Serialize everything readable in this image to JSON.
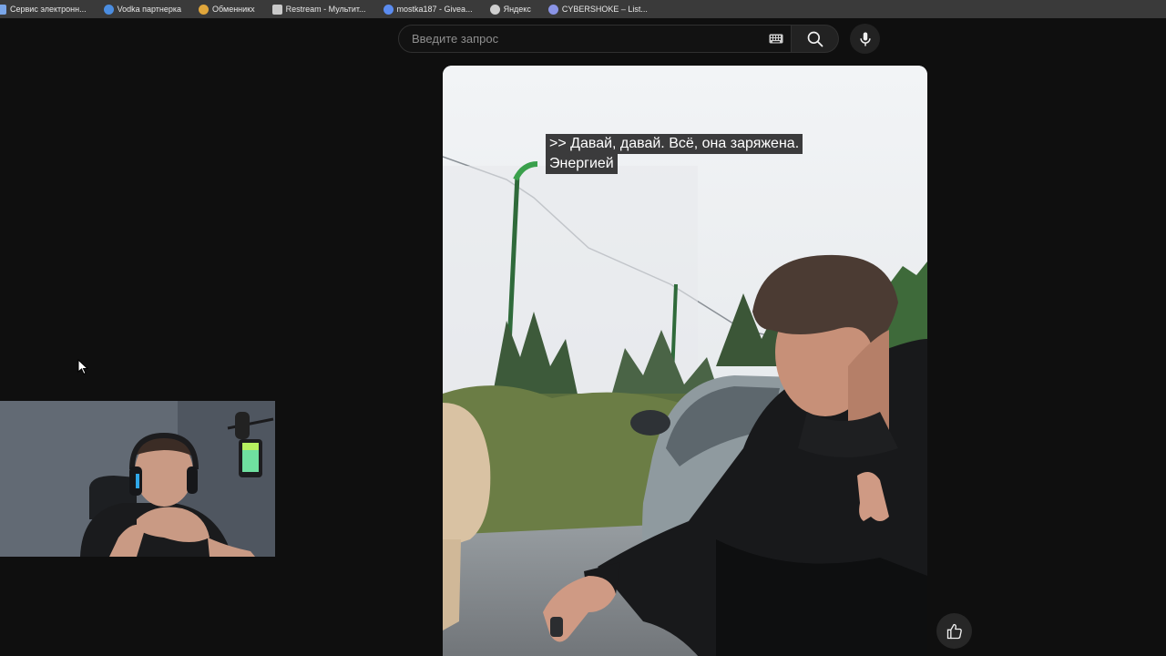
{
  "bookmarks": [
    {
      "label": "Сервис электронн...",
      "icon_color": "#7aa6e8"
    },
    {
      "label": "Vodka партнерка",
      "icon_color": "#4b8de0"
    },
    {
      "label": "Обменникх",
      "icon_color": "#e0a63b"
    },
    {
      "label": "Restream - Мультит...",
      "icon_color": "#c9c9c9"
    },
    {
      "label": "mostka187 - Givea...",
      "icon_color": "#5b8cf0"
    },
    {
      "label": "Яндекс",
      "icon_color": "#cfcfcf"
    },
    {
      "label": "CYBERSHOKE – List...",
      "icon_color": "#8a94e6"
    }
  ],
  "search": {
    "placeholder": "Введите запрос",
    "value": ""
  },
  "icons": {
    "keyboard": "keyboard-icon",
    "search": "search-icon",
    "mic": "microphone-icon",
    "like": "thumbs-up-icon",
    "cursor": "mouse-cursor-icon"
  },
  "video": {
    "caption_line1": ">> Давай, давай. Всё, она заряжена.",
    "caption_line2": "Энергией"
  },
  "colors": {
    "background": "#0f0f0f",
    "bookmarks_bar": "#3a3a3a",
    "search_field": "#121212",
    "button": "#222222"
  }
}
